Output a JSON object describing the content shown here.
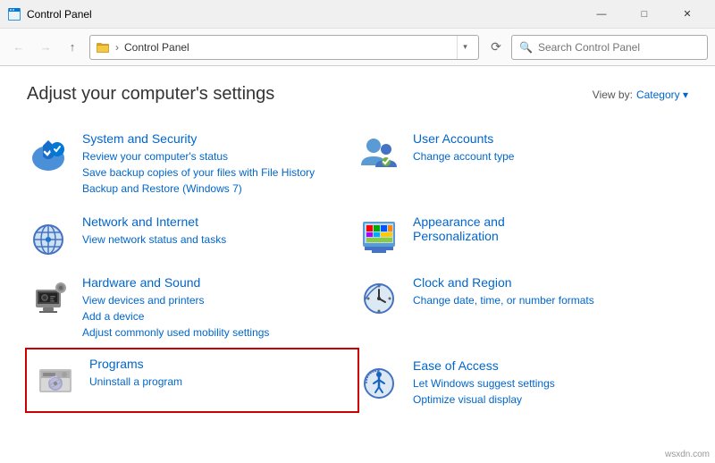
{
  "window": {
    "title": "Control Panel",
    "icon": "🖥️"
  },
  "window_controls": {
    "minimize": "—",
    "maximize": "□",
    "close": "✕"
  },
  "address_bar": {
    "back_label": "←",
    "forward_label": "→",
    "up_label": "↑",
    "nav_path": "Control Panel",
    "refresh_label": "⟳",
    "search_placeholder": "Search Control Panel"
  },
  "page": {
    "title": "Adjust your computer's settings",
    "view_by_label": "View by:",
    "view_by_value": "Category ▾"
  },
  "categories": [
    {
      "id": "system-security",
      "title": "System and Security",
      "links": [
        "Review your computer's status",
        "Save backup copies of your files with File History",
        "Backup and Restore (Windows 7)"
      ],
      "highlighted": false
    },
    {
      "id": "user-accounts",
      "title": "User Accounts",
      "links": [
        "Change account type"
      ],
      "highlighted": false
    },
    {
      "id": "network-internet",
      "title": "Network and Internet",
      "links": [
        "View network status and tasks"
      ],
      "highlighted": false
    },
    {
      "id": "appearance-personalization",
      "title": "Appearance and Personalization",
      "links": [],
      "highlighted": false
    },
    {
      "id": "hardware-sound",
      "title": "Hardware and Sound",
      "links": [
        "View devices and printers",
        "Add a device",
        "Adjust commonly used mobility settings"
      ],
      "highlighted": false
    },
    {
      "id": "clock-region",
      "title": "Clock and Region",
      "links": [
        "Change date, time, or number formats"
      ],
      "highlighted": false
    },
    {
      "id": "programs",
      "title": "Programs",
      "links": [
        "Uninstall a program"
      ],
      "highlighted": true
    },
    {
      "id": "ease-of-access",
      "title": "Ease of Access",
      "links": [
        "Let Windows suggest settings",
        "Optimize visual display"
      ],
      "highlighted": false
    }
  ],
  "watermark": "wsxdn.com"
}
